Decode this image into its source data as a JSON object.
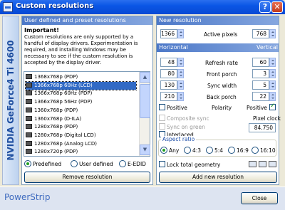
{
  "window": {
    "title": "Custom resolutions",
    "help_glyph": "?",
    "close_glyph": "✕"
  },
  "brand": {
    "gpu_name": "NVIDIA GeForce4 Ti 4600",
    "app_name": "PowerStrip"
  },
  "left": {
    "header": "User defined and preset resolutions",
    "important_title": "Important!",
    "important_body": "Custom resolutions are only supported by a handful of display drivers. Experimentation is required, and installing Windows may be necessary to see if the custom resolution is accepted by the display driver.",
    "list_items": [
      {
        "label": "1368x768p (PDP)",
        "selected": false
      },
      {
        "label": "1366x768p 60Hz (LCD)",
        "selected": true
      },
      {
        "label": "1366x768p 60Hz (PDP)",
        "selected": false
      },
      {
        "label": "1366x768p 56Hz (PDP)",
        "selected": false
      },
      {
        "label": "1360x768p (PDP)",
        "selected": false
      },
      {
        "label": "1360x768p (D-ILA)",
        "selected": false
      },
      {
        "label": "1280x768p (PDP)",
        "selected": false
      },
      {
        "label": "1280x768p (Digital LCD)",
        "selected": false
      },
      {
        "label": "1280x768p (Analog LCD)",
        "selected": false
      },
      {
        "label": "1280x720p (PDP)",
        "selected": false
      }
    ],
    "radio_options": [
      {
        "label": "Predefined",
        "checked": true
      },
      {
        "label": "User defined",
        "checked": false
      },
      {
        "label": "E-EDID",
        "checked": false
      }
    ],
    "remove_button": "Remove resolution"
  },
  "right": {
    "new_resolution_header": "New resolution",
    "width_value": "1366",
    "active_pixels_label": "Active pixels",
    "height_value": "768",
    "horizontal_header": "Horizontal",
    "vertical_header": "Vertical",
    "rows": [
      {
        "label": "Refresh rate",
        "h": "48",
        "v": "60"
      },
      {
        "label": "Front porch",
        "h": "80",
        "v": "3"
      },
      {
        "label": "Sync width",
        "h": "130",
        "v": "5"
      },
      {
        "label": "Back porch",
        "h": "210",
        "v": "22"
      }
    ],
    "positive_left": "Positive",
    "polarity_label": "Polarity",
    "positive_right": "Positive",
    "polarity_left_checked": false,
    "polarity_right_checked": true,
    "composite_sync": "Composite sync",
    "sync_on_green": "Sync on green",
    "interlaced": "Interlaced",
    "pixel_clock_label": "Pixel clock",
    "pixel_clock_value": "84.750",
    "aspect_ratio_label": "Aspect ratio",
    "aspect_options": [
      {
        "label": "Any",
        "checked": true
      },
      {
        "label": "4:3",
        "checked": false
      },
      {
        "label": "5:4",
        "checked": false
      },
      {
        "label": "16:9",
        "checked": false
      },
      {
        "label": "16:10",
        "checked": false
      }
    ],
    "lock_total_geometry": "Lock total geometry",
    "toolbar_icons": [
      "monitor-icon",
      "timing-icon",
      "chart-icon"
    ],
    "add_button": "Add new resolution"
  },
  "footer": {
    "close_button": "Close"
  },
  "colors": {
    "titlebar": "#0a56e5",
    "section_header": "#4c78c8",
    "selection": "#316ac5",
    "brand_text": "#1f4fa0"
  }
}
